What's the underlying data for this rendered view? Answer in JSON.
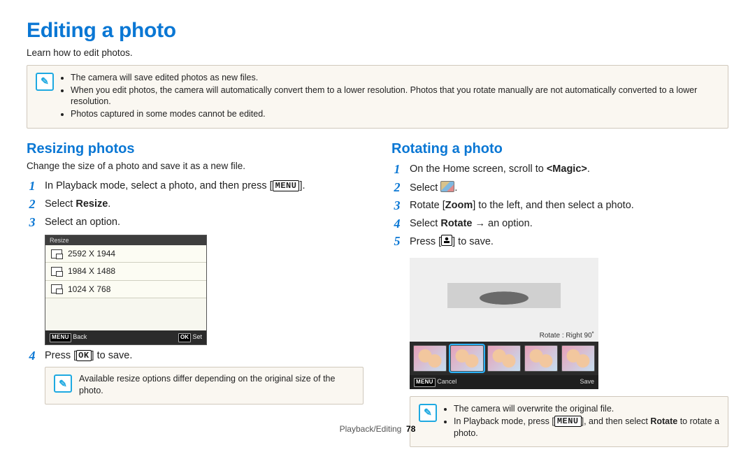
{
  "page": {
    "title": "Editing a photo",
    "subtitle": "Learn how to edit photos."
  },
  "notes_top": [
    "The camera will save edited photos as new files.",
    "When you edit photos, the camera will automatically convert them to a lower resolution. Photos that you rotate manually are not automatically converted to a lower resolution.",
    "Photos captured in some modes cannot be edited."
  ],
  "resizing": {
    "title": "Resizing photos",
    "subtitle": "Change the size of a photo and save it as a new file.",
    "steps": {
      "s1_a": "In Playback mode, select a photo, and then press [",
      "s1_menu": "MENU",
      "s1_b": "].",
      "s2_a": "Select ",
      "s2_b": "Resize",
      "s2_c": ".",
      "s3": "Select an option.",
      "s4_a": "Press [",
      "s4_ok": "OK",
      "s4_b": "] to save."
    },
    "dialog": {
      "title": "Resize",
      "options": [
        "2592 X 1944",
        "1984 X 1488",
        "1024 X 768"
      ],
      "back_icon": "MENU",
      "back": "Back",
      "set_icon": "OK",
      "set": "Set"
    },
    "note": "Available resize options differ depending on the original size of the photo."
  },
  "rotating": {
    "title": "Rotating a photo",
    "steps": {
      "s1_a": "On the Home screen, scroll to ",
      "s1_b": "<Magic>",
      "s1_c": ".",
      "s2_a": "Select ",
      "s2_b": ".",
      "s3_a": "Rotate [",
      "s3_zoom": "Zoom",
      "s3_b": "] to the left, and then select a photo.",
      "s4_a": "Select ",
      "s4_b": "Rotate",
      "s4_c": " → an option.",
      "s5_a": "Press [",
      "s5_b": "] to save."
    },
    "shot": {
      "caption": "Rotate : Right 90˚",
      "cancel_icon": "MENU",
      "cancel": "Cancel",
      "save": "Save"
    },
    "notes": {
      "n1": "The camera will overwrite the original file.",
      "n2_a": "In Playback mode, press [",
      "n2_menu": "MENU",
      "n2_b": "], and then select ",
      "n2_rotate": "Rotate",
      "n2_c": " to rotate a photo."
    }
  },
  "footer": {
    "section": "Playback/Editing",
    "page_number": "78"
  }
}
